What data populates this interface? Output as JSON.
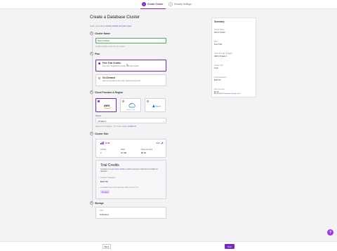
{
  "steps": [
    {
      "num": "1",
      "label": "Create Cluster"
    },
    {
      "num": "2",
      "label": "Security Settings"
    }
  ],
  "page": {
    "title": "Create a Database Cluster",
    "subtitle_prefix": "Learn more about ",
    "subtitle_link": "activity details and plan types"
  },
  "name_section": {
    "num": "1",
    "title": "Cluster Name",
    "value": "Demo Cluster",
    "hint": "Create a simple name for your cluster"
  },
  "plan_section": {
    "num": "2",
    "title": "Plan",
    "options": [
      {
        "title": "Free Trial Credits",
        "desc": "Test your SingleStore cluster with trial credits"
      },
      {
        "title": "On-Demand",
        "desc": "Set up a cluster of any size. Cancel at any time."
      }
    ]
  },
  "provider_section": {
    "num": "3",
    "title": "Cloud Provider & Region",
    "providers": [
      {
        "name": "aws",
        "label": "AWS"
      },
      {
        "name": "google-cloud",
        "label": "Google Cloud"
      },
      {
        "name": "azure",
        "label": "Azure"
      }
    ],
    "region_label": "Region",
    "region_value": "US East 1",
    "region_hint_prefix": "Region is US Virginia · To confirm region ",
    "region_hint_link": "Contact Us"
  },
  "size_section": {
    "num": "4",
    "title": "Cluster Size",
    "size": "S-00",
    "edit": "Edit",
    "metrics": [
      {
        "k": "vCPUs",
        "v": "2"
      },
      {
        "k": "RAM",
        "v": "16 GB"
      },
      {
        "k": "Price per hour",
        "v": "$0.49"
      }
    ]
  },
  "trial": {
    "title": "Trial Credits",
    "desc_prefix": "Contact us to get ",
    "desc_link": "more credits",
    "desc_suffix": " or add a payment method to be billed on-demand",
    "balance_label": "CURRENT BALANCE",
    "balance_value": "$227.60",
    "runtime_label": "ESTIMATED RUN TIME BEFORE CREDITS RUN OUT",
    "runtime_value": "19 days"
  },
  "storage_section": {
    "num": "5",
    "title": "Storage",
    "limit_label": "Limit",
    "limit_value": "Unlimited"
  },
  "summary": {
    "title": "Summary",
    "rows": [
      {
        "k": "Cluster Name",
        "v": "Demo Cluster"
      },
      {
        "k": "Plan",
        "v": "Free Trial"
      },
      {
        "k": "Cloud Provider & Region",
        "v": "AWS US East 1"
      },
      {
        "k": "Cluster Size",
        "v": "S-00"
      },
      {
        "k": "Current balance",
        "v": "$227.60"
      },
      {
        "k": "Price per hour",
        "v": "$0.49"
      }
    ],
    "bar_label": "Based: $0.00",
    "bar_link": "Estimated monthly costs"
  },
  "footer": {
    "back": "Back",
    "next": "Next"
  },
  "help": "?",
  "colors": {
    "accent": "#7a26c1",
    "valid": "#4caf50"
  }
}
